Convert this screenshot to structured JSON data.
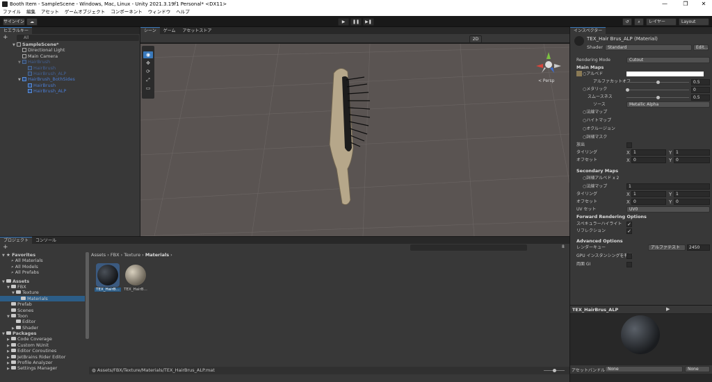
{
  "window": {
    "title": "Booth Item - SampleScene - Windows, Mac, Linux - Unity 2021.3.19f1 Personal* <DX11>",
    "minimize": "—",
    "maximize": "❐",
    "close": "✕"
  },
  "menu": [
    "ファイル",
    "編集",
    "アセット",
    "ゲームオブジェクト",
    "コンポーネント",
    "ウィンドウ",
    "ヘルプ"
  ],
  "toolbar": {
    "signin": "サインイン",
    "cloud": "☁",
    "play": "▶",
    "pause": "❚❚",
    "step": "▶❚",
    "history": "↺",
    "search": "⌕",
    "layers": "レイヤー",
    "layout": "Layout"
  },
  "hierarchy": {
    "tab": "ヒエラルキー",
    "search_placeholder": "All",
    "rows": [
      {
        "label": "SampleScene*",
        "style": "scene"
      },
      {
        "label": "Directional Light",
        "style": "normal"
      },
      {
        "label": "Main Camera",
        "style": "normal"
      },
      {
        "label": "HairBrush",
        "style": "disabled"
      },
      {
        "label": "HairBrush",
        "style": "disabled"
      },
      {
        "label": "HairBrush_ALP",
        "style": "disabled"
      },
      {
        "label": "HairBrush_BothSides",
        "style": "prefab"
      },
      {
        "label": "HairBrush",
        "style": "prefab"
      },
      {
        "label": "HairBrush_ALP",
        "style": "prefab"
      }
    ]
  },
  "scene": {
    "tabs": [
      "シーン",
      "ゲーム",
      "アセットストア"
    ],
    "mode_2d": "2D",
    "persp": "< Persp",
    "axis_y": "y",
    "axis_x": "x",
    "axis_z": "z"
  },
  "inspector": {
    "tab": "インスペクター",
    "material_name": "TEX_Hair Brus_ALP (Material)",
    "shader_label": "Shader",
    "shader_value": "Standard",
    "edit": "Edit...",
    "rendering_mode_label": "Rendering Mode",
    "rendering_mode_value": "Cutout",
    "main_maps": "Main Maps",
    "albedo": "○アルベド",
    "alpha_cutoff": "アルファカットオフ",
    "alpha_cutoff_value": "0.5",
    "metallic": "○メタリック",
    "metallic_value": "0",
    "smoothness": "スムースネス",
    "smoothness_value": "0.5",
    "source": "ソース",
    "source_value": "Metallic Alpha",
    "normal_map": "○法線マップ",
    "height_map": "○ハイトマップ",
    "occlusion": "○オクルージョン",
    "detail_mask": "○詳細マスク",
    "emission": "放出",
    "tiling": "タイリング",
    "offset": "オフセット",
    "x": "X",
    "y": "Y",
    "tiling_x": "1",
    "tiling_y": "1",
    "offset_x": "0",
    "offset_y": "0",
    "secondary_maps": "Secondary Maps",
    "detail_albedo": "○詳細アルベド x 2",
    "detail_normal": "○法線マップ",
    "detail_normal_value": "1",
    "tiling2_x": "1",
    "tiling2_y": "1",
    "offset2_x": "0",
    "offset2_y": "0",
    "uv_set": "UV セット",
    "uv_set_value": "UV0",
    "forward_options": "Forward Rendering Options",
    "specular": "スペキュラーハイライト",
    "reflections": "リフレクション",
    "advanced": "Advanced Options",
    "render_queue": "レンダーキュー",
    "render_queue_mode": "アルファテスト",
    "render_queue_value": "2450",
    "gpu_instancing": "GPU インスタンシングを有効",
    "double_gi": "両面 GI",
    "preview_title": "TEX_HairBrus_ALP",
    "asset_bundle": "アセットバンドル",
    "bundle_value": "None",
    "bundle_variant": "None"
  },
  "project": {
    "tabs": [
      "プロジェクト",
      "コンソール"
    ],
    "favorites": "Favorites",
    "fav_items": [
      "All Materials",
      "All Models",
      "All Prefabs"
    ],
    "assets": "Assets",
    "tree": [
      {
        "label": "FBX",
        "depth": 1
      },
      {
        "label": "Texture",
        "depth": 2
      },
      {
        "label": "Materials",
        "depth": 3
      },
      {
        "label": "Prefab",
        "depth": 1
      },
      {
        "label": "Scenes",
        "depth": 1
      },
      {
        "label": "Toon",
        "depth": 1
      },
      {
        "label": "Editor",
        "depth": 2
      },
      {
        "label": "Shader",
        "depth": 2
      }
    ],
    "packages": "Packages",
    "pkg_items": [
      "Code Coverage",
      "Custom NUnit",
      "Editor Coroutines",
      "JetBrains Rider Editor",
      "Profile Analyzer",
      "Settings Manager"
    ],
    "breadcrumb": [
      "Assets",
      "FBX",
      "Texture",
      "Materials"
    ],
    "files": [
      {
        "name": "TEX_HairB..."
      },
      {
        "name": "TEX_HairB..."
      }
    ],
    "path": "Assets/FBX/Texture/Materials/TEX_HairBrus_ALP.mat",
    "hidden_count": "8"
  },
  "colors": {
    "accent": "#3a79bb",
    "scene_bg": "#5a5452",
    "panel": "#383838"
  }
}
